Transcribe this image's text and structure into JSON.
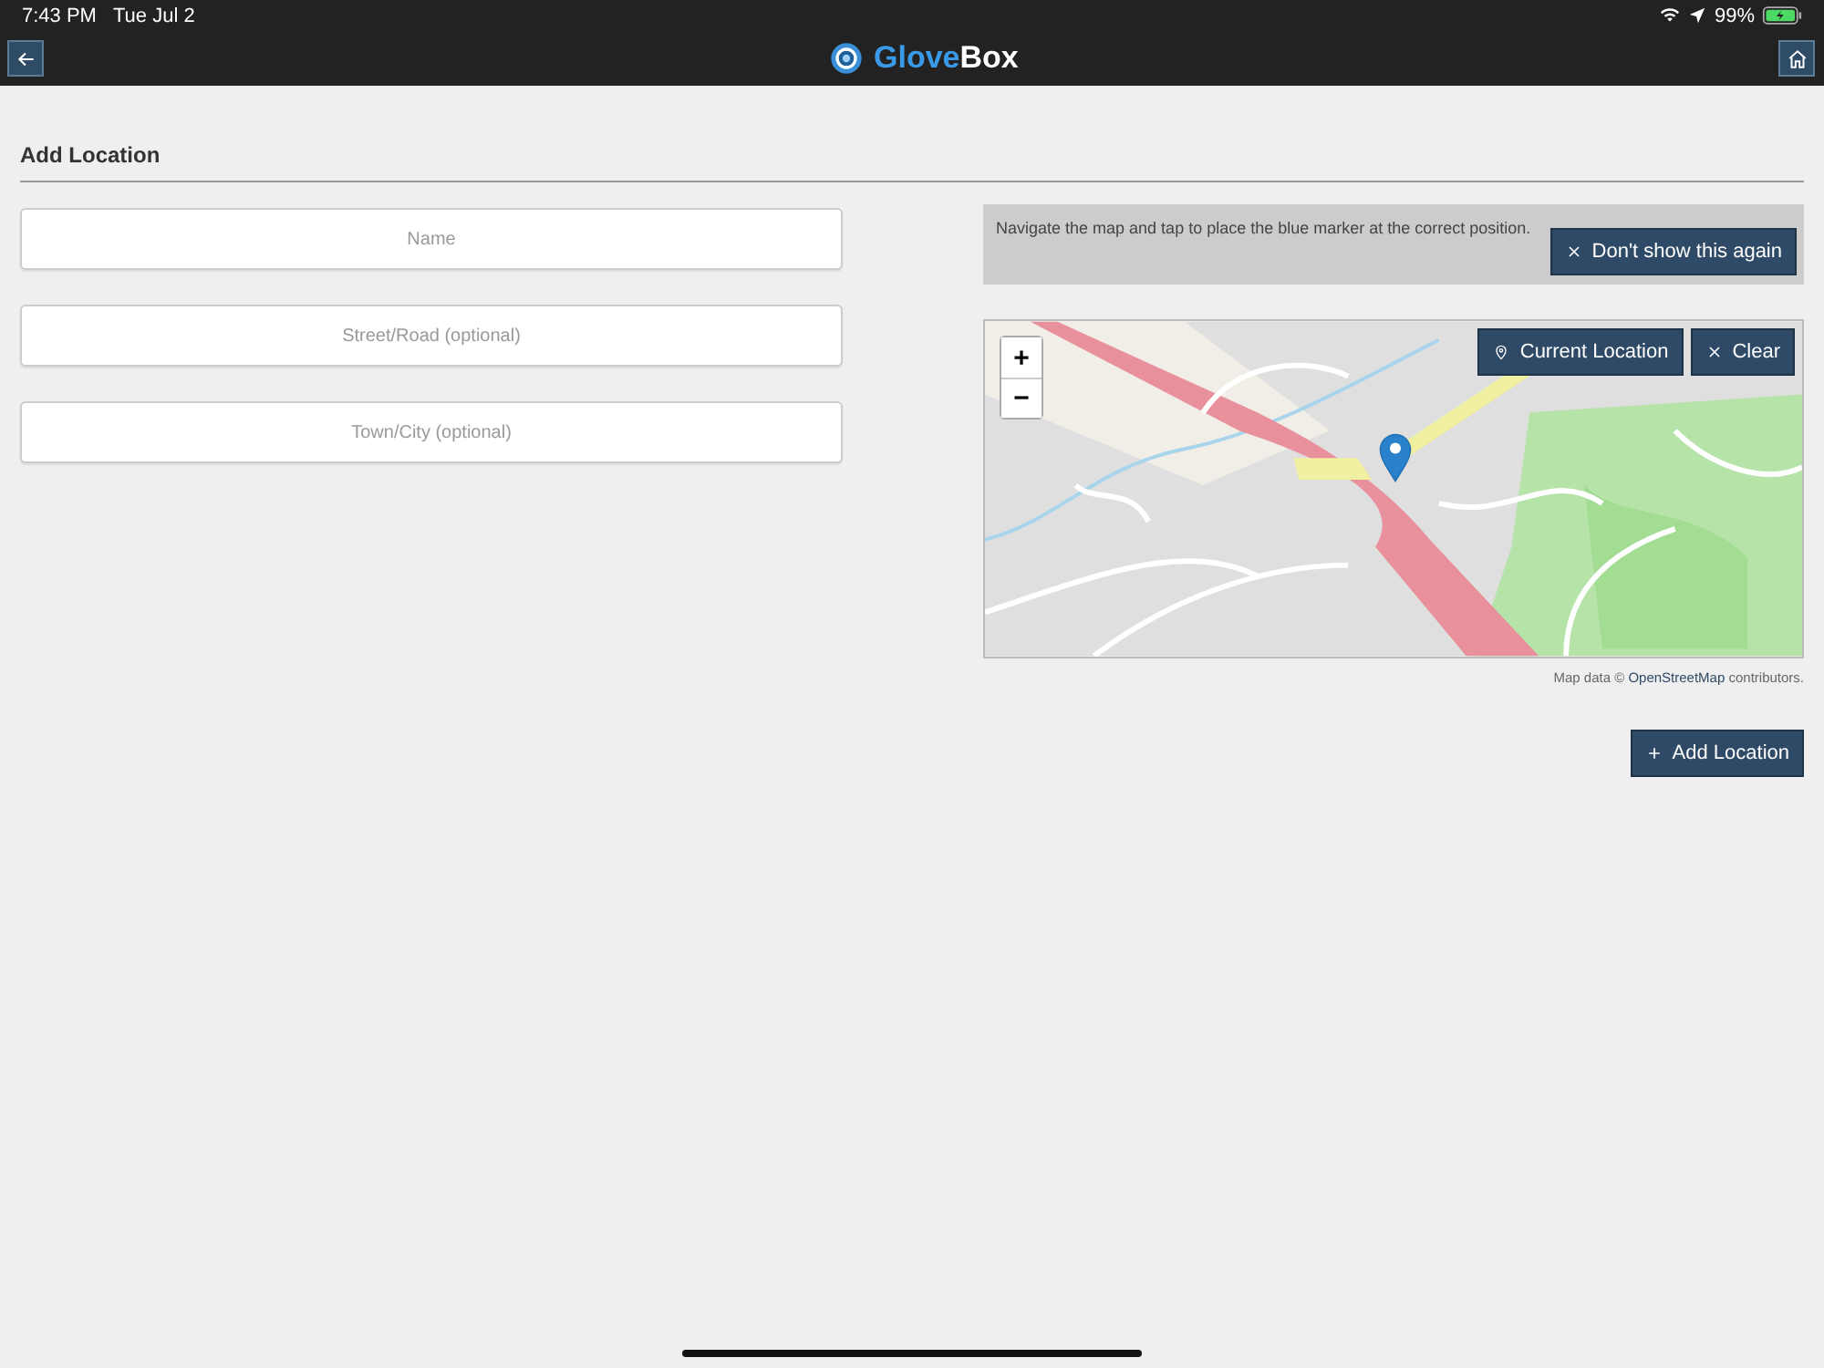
{
  "status_bar": {
    "time": "7:43 PM",
    "date": "Tue Jul 2",
    "battery": "99%"
  },
  "nav_bar": {
    "brand": {
      "first": "Glove",
      "second": "Box"
    }
  },
  "page": {
    "title": "Add Location"
  },
  "form": {
    "fields": [
      {
        "placeholder": "Name"
      },
      {
        "placeholder": "Street/Road (optional)"
      },
      {
        "placeholder": "Town/City (optional)"
      }
    ]
  },
  "hint": {
    "text": "Navigate the map and tap to place the blue marker at the correct position.",
    "dismiss_button": "Don't show this again"
  },
  "map": {
    "zoom_in": "+",
    "zoom_out": "−",
    "current_location_button": "Current Location",
    "clear_button": "Clear",
    "attribution": {
      "before": "Map data © ",
      "link": "OpenStreetMap",
      "after": " contributors."
    }
  },
  "add_button": "Add Location"
}
